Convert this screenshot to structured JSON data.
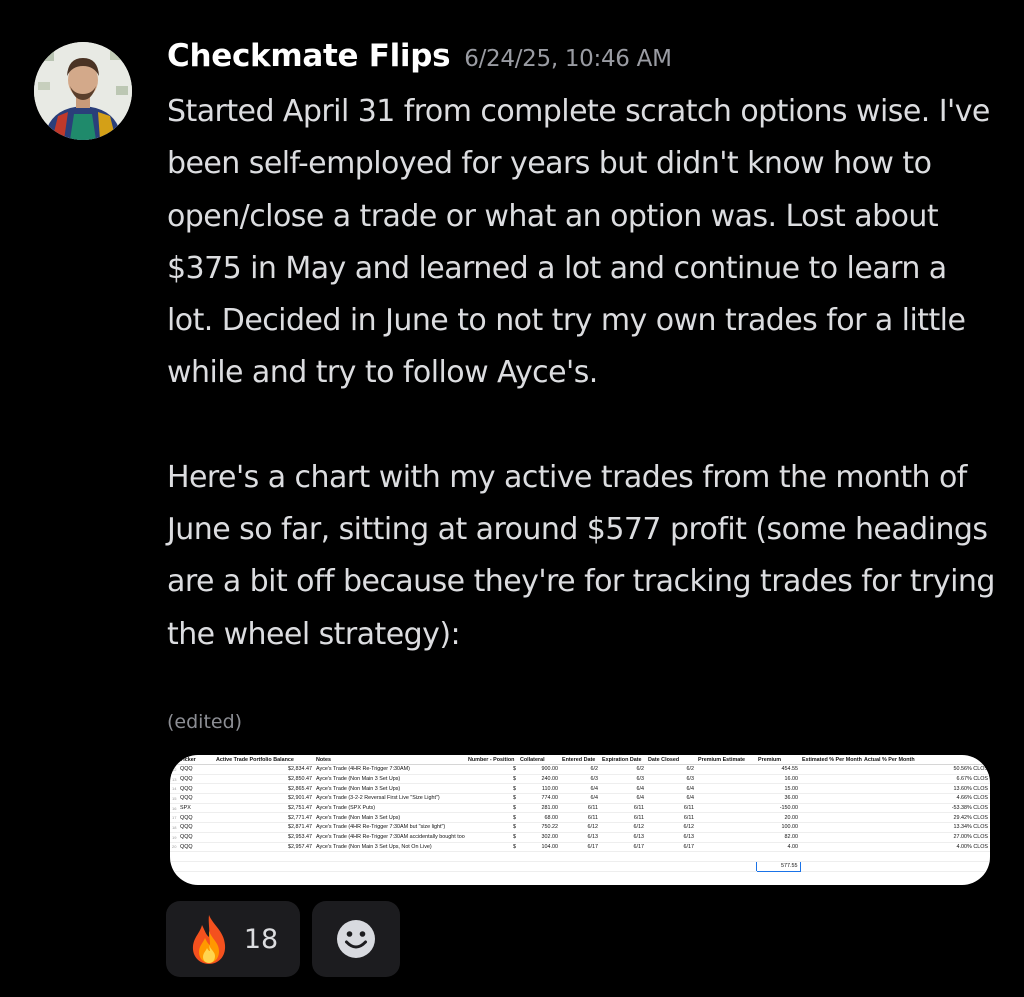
{
  "message": {
    "author": "Checkmate Flips",
    "timestamp": "6/24/25, 10:46 AM",
    "para1": "Started April 31 from complete scratch options wise.  I've been self-employed for years but didn't know how to open/close a trade or what an option was.  Lost about $375 in May and learned a lot and continue to learn a lot.  Decided in June to not try my own trades for a little while and try to follow Ayce's.",
    "para2": "Here's a chart with my active trades from the month of June so far, sitting at around $577 profit (some headings are a bit off because they're for tracking trades for trying the wheel strategy):",
    "edited": "(edited)"
  },
  "attachment": {
    "columns": [
      "",
      "Ticker",
      "Active Trade Portfolio Balance",
      "Notes",
      "Number - Position",
      "Collateral",
      "Entered Date",
      "Expiration Date",
      "Date Closed",
      "Premium Estimate",
      "Premium",
      "Estimated % Per Month",
      "Actual % Per Month"
    ],
    "rows": [
      {
        "n": "12",
        "ticker": "QQQ",
        "balance": "$2,834.47",
        "notes": "Ayce's Trade (4HR Re-Trigger 7:30AM)",
        "cur": "$",
        "collateral": "900.00",
        "entered": "6/2",
        "expiration": "6/2",
        "closed": "6/2",
        "premium": "454.55",
        "actual": "50.56% CLOS"
      },
      {
        "n": "13",
        "ticker": "QQQ",
        "balance": "$2,850.47",
        "notes": "Ayce's Trade (Non Main 3 Set Ups)",
        "cur": "$",
        "collateral": "240.00",
        "entered": "6/3",
        "expiration": "6/3",
        "closed": "6/3",
        "premium": "16.00",
        "actual": "6.67% CLOS"
      },
      {
        "n": "14",
        "ticker": "QQQ",
        "balance": "$2,865.47",
        "notes": "Ayce's Trade (Non Main 3 Set Ups)",
        "cur": "$",
        "collateral": "110.00",
        "entered": "6/4",
        "expiration": "6/4",
        "closed": "6/4",
        "premium": "15.00",
        "actual": "13.60% CLOS"
      },
      {
        "n": "15",
        "ticker": "QQQ",
        "balance": "$2,901.47",
        "notes": "Ayce's Trade (3-2-2 Reversal First Live \"Size Light\")",
        "cur": "$",
        "collateral": "774.00",
        "entered": "6/4",
        "expiration": "6/4",
        "closed": "6/4",
        "premium": "36.00",
        "actual": "4.66% CLOS"
      },
      {
        "n": "16",
        "ticker": "SPX",
        "balance": "$2,751.47",
        "notes": "Ayce's Trade (SPX Puts)",
        "cur": "$",
        "collateral": "281.00",
        "entered": "6/11",
        "expiration": "6/11",
        "closed": "6/11",
        "premium": "-150.00",
        "actual": "-53.38% CLOS"
      },
      {
        "n": "17",
        "ticker": "QQQ",
        "balance": "$2,771.47",
        "notes": "Ayce's Trade (Non Main 3 Set Ups)",
        "cur": "$",
        "collateral": "68.00",
        "entered": "6/11",
        "expiration": "6/11",
        "closed": "6/11",
        "premium": "20.00",
        "actual": "29.42% CLOS"
      },
      {
        "n": "18",
        "ticker": "QQQ",
        "balance": "$2,871.47",
        "notes": "Ayce's Trade (4HR Re-Trigger 7:30AM but \"size light\")",
        "cur": "$",
        "collateral": "750.22",
        "entered": "6/12",
        "expiration": "6/12",
        "closed": "6/12",
        "premium": "100.00",
        "actual": "13.34% CLOS"
      },
      {
        "n": "19",
        "ticker": "QQQ",
        "balance": "$2,953.47",
        "notes": "Ayce's Trade (4HR Re-Trigger 7:30AM accidentally bought too little)",
        "cur": "$",
        "collateral": "302.00",
        "entered": "6/13",
        "expiration": "6/13",
        "closed": "6/13",
        "premium": "82.00",
        "actual": "27.00% CLOS"
      },
      {
        "n": "20",
        "ticker": "QQQ",
        "balance": "$2,957.47",
        "notes": "Ayce's Trade (Non Main 3 Set Ups, Not On Live)",
        "cur": "$",
        "collateral": "104.00",
        "entered": "6/17",
        "expiration": "6/17",
        "closed": "6/17",
        "premium": "4.00",
        "actual": "4.00% CLOS"
      }
    ],
    "total_premium": "577.55"
  },
  "reactions": {
    "fire_icon": "fire-emoji",
    "fire_count": "18",
    "add_icon": "smile-icon"
  }
}
